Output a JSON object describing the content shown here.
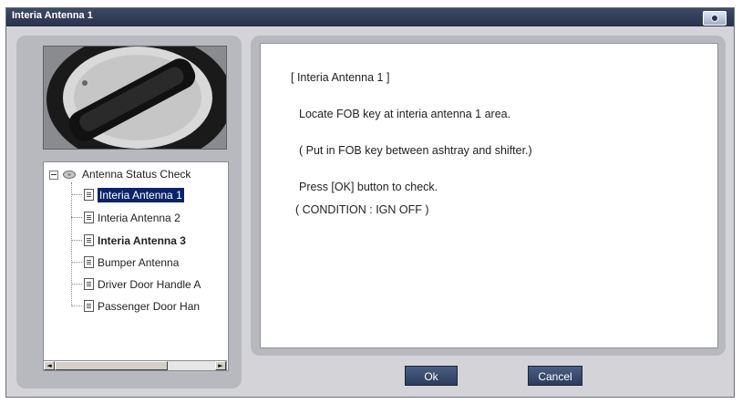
{
  "window": {
    "title": "Interia Antenna 1"
  },
  "icons": {
    "title_camera": "camera-icon",
    "tree_root": "disk-icon",
    "tree_item": "document-icon",
    "scroll_left": "arrow-left-icon",
    "scroll_right": "arrow-right-icon"
  },
  "tree": {
    "root_label": "Antenna Status Check",
    "items": [
      {
        "label": "Interia Antenna 1"
      },
      {
        "label": "Interia Antenna 2"
      },
      {
        "label": "Interia Antenna 3"
      },
      {
        "label": "Bumper Antenna"
      },
      {
        "label": "Driver Door Handle A"
      },
      {
        "label": "Passenger Door Han"
      }
    ],
    "scroll_left_glyph": "◄",
    "scroll_right_glyph": "►"
  },
  "message": {
    "heading": "[ Interia Antenna 1 ]",
    "line1": "Locate FOB key at interia antenna 1 area.",
    "line2": "( Put in FOB key between ashtray and shifter.)",
    "line3": "Press [OK] button to check.",
    "line4": "( CONDITION : IGN OFF )"
  },
  "buttons": {
    "ok": "Ok",
    "cancel": "Cancel"
  },
  "colors": {
    "titlebar": "#27324b",
    "selection": "#0a246a",
    "button": "#2b3c5c",
    "panel": "#b7b9be"
  }
}
